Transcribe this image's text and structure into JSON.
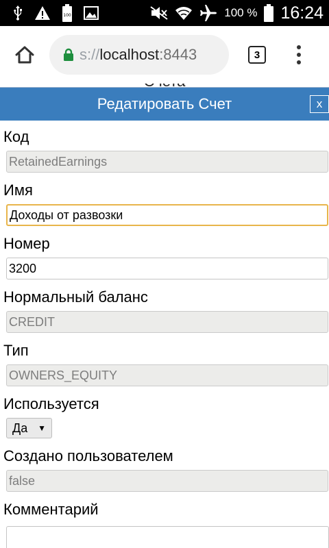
{
  "status_bar": {
    "battery_percent": "100 %",
    "time": "16:24",
    "icons": [
      "usb-icon",
      "warning-icon",
      "battery-full-icon",
      "image-icon",
      "mute-icon",
      "wifi-icon",
      "airplane-icon",
      "battery-icon"
    ]
  },
  "browser": {
    "url_prefix": "s://",
    "url_host": "localhost",
    "url_port": ":8443",
    "tab_count": "3"
  },
  "background_page": {
    "title": "Счета"
  },
  "dialog": {
    "title": "Редатировать Счет",
    "close_label": "x",
    "fields": {
      "code": {
        "label": "Код",
        "value": "RetainedEarnings"
      },
      "name": {
        "label": "Имя",
        "value": "Доходы от развозки"
      },
      "number": {
        "label": "Номер",
        "value": "3200"
      },
      "normal_balance": {
        "label": "Нормальный баланс",
        "value": "CREDIT"
      },
      "type": {
        "label": "Тип",
        "value": "OWNERS_EQUITY"
      },
      "used": {
        "label": "Используется",
        "value": "Да"
      },
      "created_by_user": {
        "label": "Создано пользователем",
        "value": "false"
      },
      "comment": {
        "label": "Комментарий",
        "value": ""
      }
    }
  },
  "colors": {
    "dialog_header": "#3a7dbd",
    "focus_border": "#e8b54a",
    "readonly_bg": "#ececea",
    "lock_green": "#1e8e3e"
  }
}
